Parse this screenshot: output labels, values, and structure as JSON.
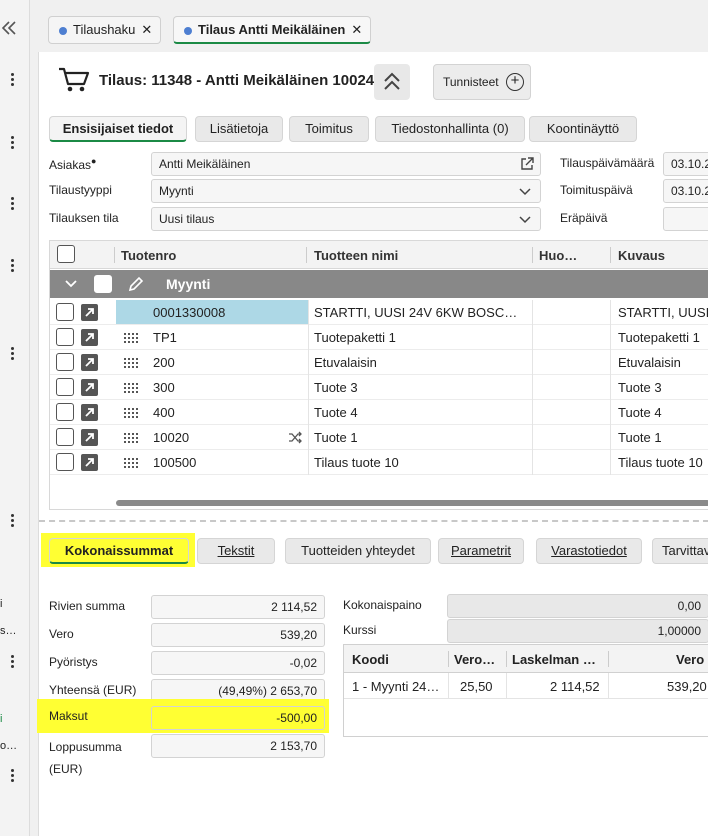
{
  "rail": {
    "collapse_icon": "double-chevron-left-icon",
    "fragments": [
      "i",
      "s…",
      "i",
      "o…"
    ]
  },
  "doc_tabs": [
    {
      "label": "Tilaushaku",
      "close": "✕"
    },
    {
      "label": "Tilaus Antti Meikäläinen",
      "close": "✕"
    }
  ],
  "header": {
    "title": "Tilaus: 11348 - Antti Meikäläinen 10024",
    "tags_label": "Tunnisteet",
    "tags_plus": "+"
  },
  "tabs": [
    "Ensisijaiset tiedot",
    "Lisätietoja",
    "Toimitus",
    "Tiedostonhallinta (0)",
    "Koontinäyttö"
  ],
  "form": {
    "asiakas_label": "Asiakas",
    "asiakas_value": "Antti Meikäläinen",
    "tilaustyyppi_label": "Tilaustyyppi",
    "tilaustyyppi_value": "Myynti",
    "tila_label": "Tilauksen tila",
    "tila_value": "Uusi tilaus",
    "tilauspvm_label": "Tilauspäivämäärä",
    "tilauspvm_value": "03.10.2",
    "toimituspvm_label": "Toimituspäivä",
    "toimituspvm_value": "03.10.2",
    "erapaiva_label": "Eräpäivä",
    "erapaiva_value": ""
  },
  "grid": {
    "columns": [
      "Tuotenro",
      "Tuotteen nimi",
      "Huo…",
      "Kuvaus"
    ],
    "group_label": "Myynti",
    "rows": [
      {
        "nro": "0001330008",
        "nimi": "STARTTI, UUSI 24V 6KW BOSC…",
        "huo": "",
        "kuvaus": "STARTTI, UUSI"
      },
      {
        "nro": "TP1",
        "nimi": "Tuotepaketti 1",
        "huo": "",
        "kuvaus": "Tuotepaketti 1"
      },
      {
        "nro": "200",
        "nimi": "Etuvalaisin",
        "huo": "",
        "kuvaus": "Etuvalaisin"
      },
      {
        "nro": "300",
        "nimi": "Tuote 3",
        "huo": "",
        "kuvaus": "Tuote 3"
      },
      {
        "nro": "400",
        "nimi": "Tuote 4",
        "huo": "",
        "kuvaus": "Tuote 4"
      },
      {
        "nro": "10020",
        "nimi": "Tuote 1",
        "huo": "",
        "kuvaus": "Tuote 1"
      },
      {
        "nro": "100500",
        "nimi": "Tilaus tuote 10",
        "huo": "",
        "kuvaus": "Tilaus tuote 10"
      }
    ]
  },
  "bottom_tabs": [
    "Kokonaissummat",
    "Tekstit",
    "Tuotteiden yhteydet",
    "Parametrit",
    "Varastotiedot",
    "Tarvittav"
  ],
  "totals": {
    "rivien_summa_label": "Rivien summa",
    "rivien_summa": "2 114,52",
    "vero_label": "Vero",
    "vero": "539,20",
    "pyoristys_label": "Pyöristys",
    "pyoristys": "-0,02",
    "yhteensa_label": "Yhteensä (EUR)",
    "yhteensa": "(49,49%) 2 653,70",
    "maksut_label": "Maksut",
    "maksut": "-500,00",
    "loppusumma_label_1": "Loppusumma",
    "loppusumma_label_2": "(EUR)",
    "loppusumma": "2 153,70",
    "kokonaispaino_label": "Kokonaispaino",
    "kokonaispaino": "0,00",
    "kurssi_label": "Kurssi",
    "kurssi": "1,00000"
  },
  "tax_grid": {
    "columns": [
      "Koodi",
      "Vero…",
      "Laskelman …",
      "Vero"
    ],
    "rows": [
      {
        "koodi": "1 - Myynti 24…",
        "vero": "25,50",
        "laskelma": "2 114,52",
        "veroeur": "539,20"
      }
    ]
  },
  "colors": {
    "highlight": "#ffff33",
    "accent": "#1b8a45",
    "selected_cell": "#add8e6"
  }
}
